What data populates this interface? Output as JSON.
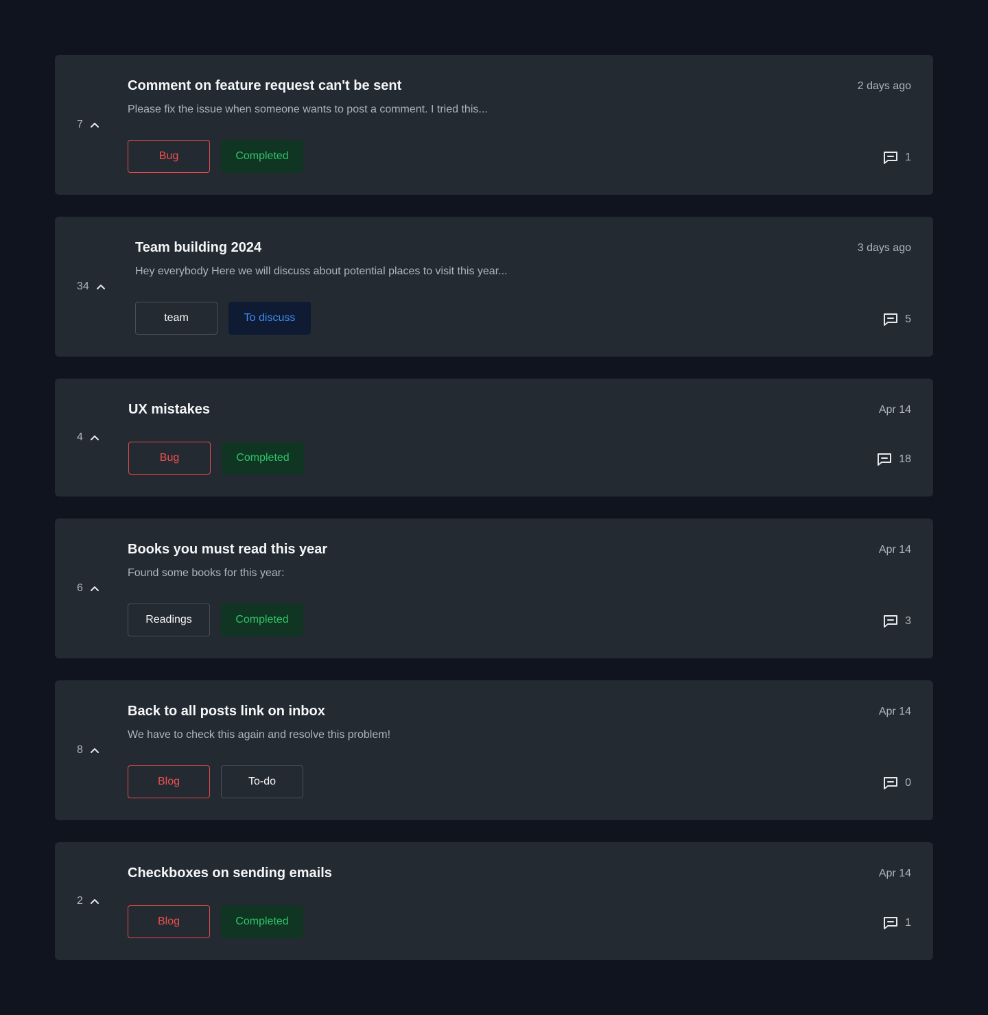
{
  "colors": {
    "background": "#0f141e",
    "card": "#242a31",
    "tag_red": "#ef4f4f",
    "tag_green": "#2ec56a",
    "tag_blue": "#3f8cf0"
  },
  "posts": [
    {
      "votes": "7",
      "vote_icon": "chevron-up-icon",
      "title": "Comment on feature request can't be sent",
      "excerpt": "Please fix the issue when someone wants to post a comment. I tried this...",
      "date": "2 days ago",
      "tags": [
        "Bug",
        "Completed"
      ],
      "comment_icon": "comment-icon",
      "comments": "1"
    },
    {
      "votes": "34",
      "vote_icon": "chevron-up-icon",
      "title": "Team building 2024",
      "excerpt": "Hey everybody Here we will discuss about potential places to visit this year...",
      "date": "3 days ago",
      "tags": [
        "team",
        "To discuss"
      ],
      "comment_icon": "comment-icon",
      "comments": "5"
    },
    {
      "votes": "4",
      "vote_icon": "chevron-up-icon",
      "title": "UX mistakes",
      "excerpt": "",
      "date": "Apr 14",
      "tags": [
        "Bug",
        "Completed"
      ],
      "comment_icon": "comment-icon",
      "comments": "18"
    },
    {
      "votes": "6",
      "vote_icon": "chevron-up-icon",
      "title": "Books you must read this year",
      "excerpt": "Found some books for this year:",
      "date": "Apr 14",
      "tags": [
        "Readings",
        "Completed"
      ],
      "comment_icon": "comment-icon",
      "comments": "3"
    },
    {
      "votes": "8",
      "vote_icon": "chevron-up-icon",
      "title": "Back to all posts link on inbox",
      "excerpt": "We have to check this again and resolve this problem!",
      "date": "Apr 14",
      "tags": [
        "Blog",
        "To-do"
      ],
      "comment_icon": "comment-icon",
      "comments": "0"
    },
    {
      "votes": "2",
      "vote_icon": "chevron-up-icon",
      "title": "Checkboxes on sending emails",
      "excerpt": "",
      "date": "Apr 14",
      "tags": [
        "Blog",
        "Completed"
      ],
      "comment_icon": "comment-icon",
      "comments": "1"
    }
  ]
}
